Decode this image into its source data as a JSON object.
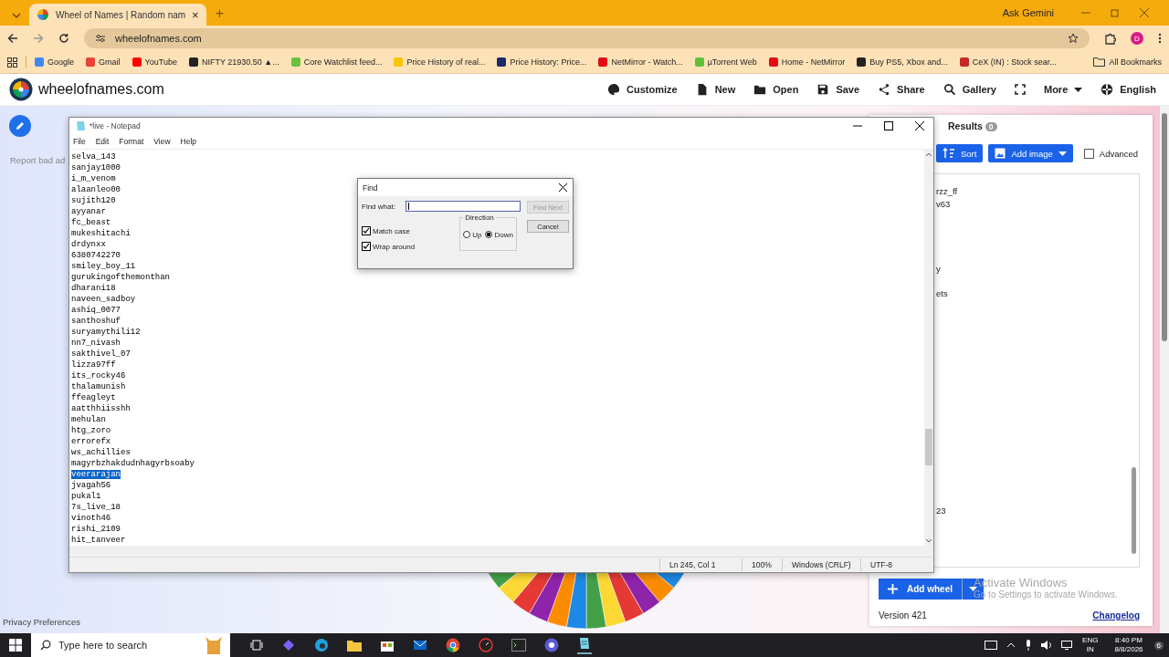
{
  "browser": {
    "tab": {
      "title": "Wheel of Names | Random nam",
      "close": "×"
    },
    "new_tab": "+",
    "ask_gemini": "Ask Gemini",
    "address": "wheelofnames.com",
    "profile": "D",
    "bookmarks": [
      "Google",
      "Gmail",
      "YouTube",
      "NIFTY 21930.50 ▲...",
      "Core Watchlist feed...",
      "Price History of real...",
      "Price History: Price...",
      "NetMirror - Watch...",
      "µTorrent Web",
      "Home - NetMirror",
      "Buy PS5, Xbox and...",
      "CeX (IN) : Stock sear..."
    ],
    "all_bookmarks": "All Bookmarks"
  },
  "site": {
    "name": "wheelofnames.com",
    "menu": [
      {
        "label": "Customize"
      },
      {
        "label": "New"
      },
      {
        "label": "Open"
      },
      {
        "label": "Save"
      },
      {
        "label": "Share"
      },
      {
        "label": "Gallery"
      },
      {
        "label": "More",
        "caret": true
      },
      {
        "label": "English"
      }
    ],
    "report_ad": "Report bad ad",
    "privacy": "Privacy Preferences",
    "panel": {
      "tabs": [
        {
          "label": "Results",
          "count": "0",
          "selected": false
        }
      ],
      "sort": "Sort",
      "add_image": "Add image",
      "advanced": {
        "label": "Advanced",
        "checked": false
      },
      "entries": [
        "rzz_ff",
        "v63",
        "y",
        "ets",
        "23"
      ],
      "add_wheel": "Add wheel",
      "version": "Version 421",
      "changelog": "Changelog"
    }
  },
  "activation": {
    "title": "Activate Windows",
    "subtitle": "Go to Settings to activate Windows."
  },
  "notepad": {
    "title": "*live - Notepad",
    "menu": [
      "File",
      "Edit",
      "Format",
      "View",
      "Help"
    ],
    "lines": [
      {
        "text": "selva_143",
        "selected": false
      },
      {
        "text": "sanjay1000",
        "selected": false
      },
      {
        "text": "i_m_venom",
        "selected": false
      },
      {
        "text": "alaanleo00",
        "selected": false
      },
      {
        "text": "sujith120",
        "selected": false
      },
      {
        "text": "ayyanar",
        "selected": false
      },
      {
        "text": "fc_beast",
        "selected": false
      },
      {
        "text": "mukeshitachi",
        "selected": false
      },
      {
        "text": "drdynxx",
        "selected": false
      },
      {
        "text": "6380742270",
        "selected": false
      },
      {
        "text": "smiley_boy_11",
        "selected": false
      },
      {
        "text": "gurukingofthemonthan",
        "selected": false
      },
      {
        "text": "dharani18",
        "selected": false
      },
      {
        "text": "naveen_sadboy",
        "selected": false
      },
      {
        "text": "ashiq_0077",
        "selected": false
      },
      {
        "text": "santhoshuf",
        "selected": false
      },
      {
        "text": "suryamythili12",
        "selected": false
      },
      {
        "text": "nn7_nivash",
        "selected": false
      },
      {
        "text": "sakthivel_07",
        "selected": false
      },
      {
        "text": "lizza97ff",
        "selected": false
      },
      {
        "text": "its_rocky46",
        "selected": false
      },
      {
        "text": "thalamunish",
        "selected": false
      },
      {
        "text": "ffeagleyt",
        "selected": false
      },
      {
        "text": "aatthhiisshh",
        "selected": false
      },
      {
        "text": "mehulan",
        "selected": false
      },
      {
        "text": "htg_zoro",
        "selected": false
      },
      {
        "text": "errorefx",
        "selected": false
      },
      {
        "text": "ws_achillies",
        "selected": false
      },
      {
        "text": "magyrbzhakdudnhagyrbsoaby",
        "selected": false
      },
      {
        "text": "veerarajan",
        "selected": true
      },
      {
        "text": "jvagah56",
        "selected": false
      },
      {
        "text": "pukal1",
        "selected": false
      },
      {
        "text": "7s_live_18",
        "selected": false
      },
      {
        "text": "vinoth46",
        "selected": false
      },
      {
        "text": "rishi_2109",
        "selected": false
      },
      {
        "text": "hit_tanveer",
        "selected": false
      }
    ],
    "status": [
      "Ln 245, Col 1",
      "100%",
      "Windows (CRLF)",
      "UTF-8"
    ]
  },
  "find": {
    "title": "Find",
    "label": "Find what:",
    "find_next": {
      "label": "Find Next",
      "disabled": true
    },
    "cancel": "Cancel",
    "direction": {
      "label": "Direction",
      "options": [
        {
          "label": "Up",
          "selected": false
        },
        {
          "label": "Down",
          "selected": true
        }
      ]
    },
    "options": [
      {
        "label": "Match case",
        "checked": true
      },
      {
        "label": "Wrap around",
        "checked": true
      }
    ]
  },
  "taskbar": {
    "search": "Type here to search",
    "lang": "ENG",
    "region": "IN",
    "time": "8:40 PM",
    "date": "8/8/2026",
    "notifications": "6"
  }
}
